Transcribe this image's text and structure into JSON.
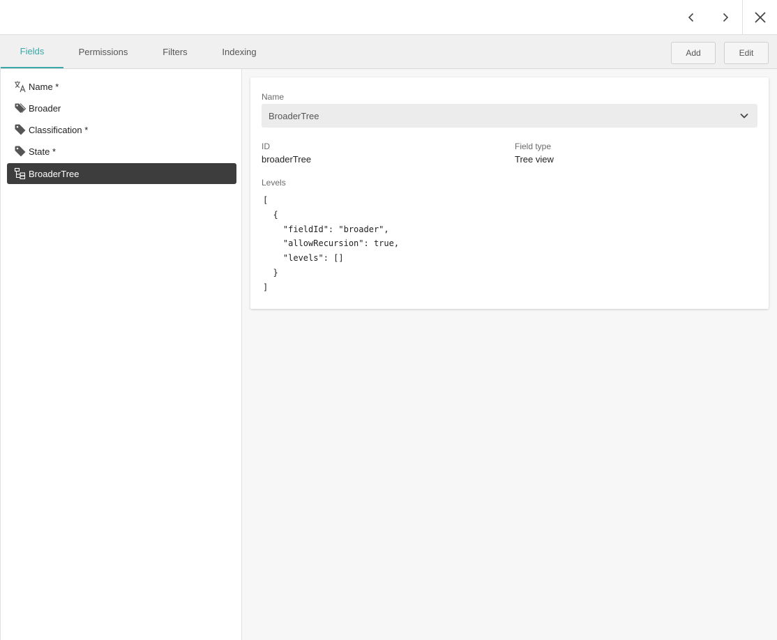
{
  "topbar": {
    "prev_icon": "chevron-left-icon",
    "next_icon": "chevron-right-icon",
    "close_icon": "close-icon"
  },
  "tabs": [
    {
      "label": "Fields",
      "active": true
    },
    {
      "label": "Permissions",
      "active": false
    },
    {
      "label": "Filters",
      "active": false
    },
    {
      "label": "Indexing",
      "active": false
    }
  ],
  "actions": {
    "add_label": "Add",
    "edit_label": "Edit"
  },
  "fields": [
    {
      "label": "Name *",
      "icon": "translate-icon",
      "selected": false
    },
    {
      "label": "Broader",
      "icon": "tag-icon",
      "selected": false
    },
    {
      "label": "Classification *",
      "icon": "tag-icon",
      "selected": false
    },
    {
      "label": "State *",
      "icon": "tag-icon",
      "selected": false
    },
    {
      "label": "BroaderTree",
      "icon": "tree-view-icon",
      "selected": true
    }
  ],
  "detail": {
    "name_label": "Name",
    "name_value": "BroaderTree",
    "id_label": "ID",
    "id_value": "broaderTree",
    "type_label": "Field type",
    "type_value": "Tree view",
    "levels_label": "Levels",
    "levels_code": "[\n  {\n    \"fieldId\": \"broader\",\n    \"allowRecursion\": true,\n    \"levels\": []\n  }\n]"
  },
  "colors": {
    "accent": "#3aa8a8",
    "selected_bg": "#3d3d3d"
  }
}
